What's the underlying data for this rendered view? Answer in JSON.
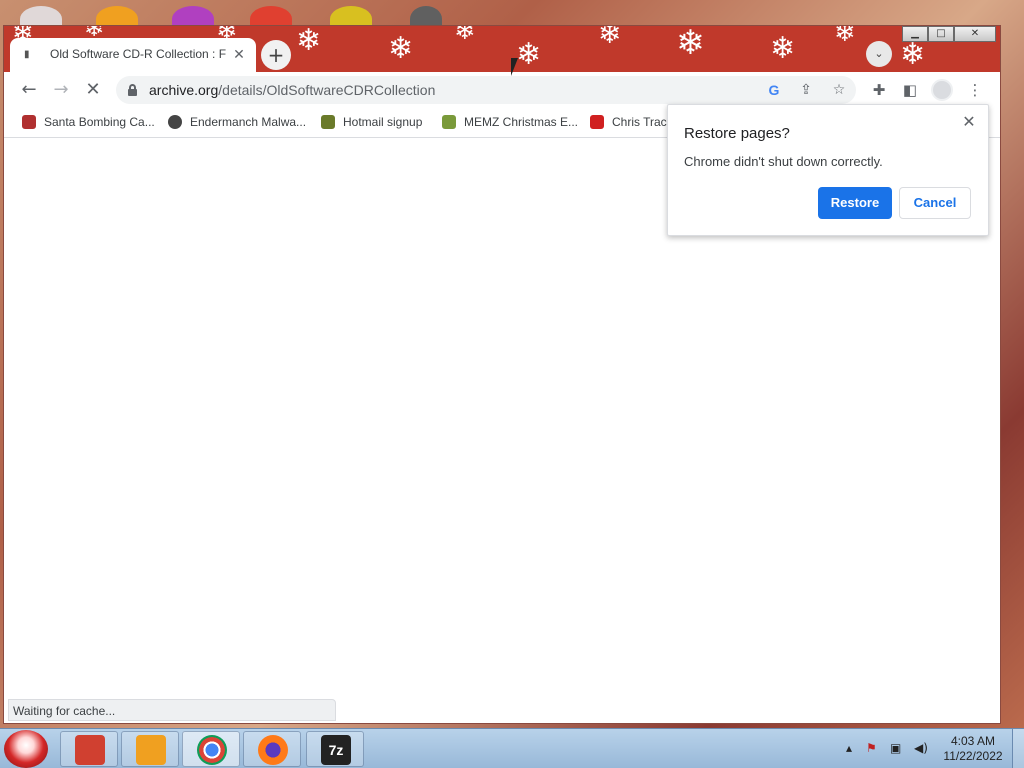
{
  "browser": {
    "tab": {
      "title": "Old Software CD-R Collection : F",
      "favicon": "archive-icon",
      "close_glyph": "✕"
    },
    "new_tab_glyph": "+",
    "tab_search_glyph": "⌄",
    "window_controls": [
      "minimize",
      "maximize",
      "close"
    ],
    "url_host": "archive.org",
    "url_path": "/details/OldSoftwareCDRCollection",
    "google_glyph": "G",
    "status_text": "Waiting for cache..."
  },
  "bookmarks": [
    {
      "label": "Santa Bombing Ca...",
      "icon": "santa-icon",
      "color": "#b03030"
    },
    {
      "label": "Endermanch Malwa...",
      "icon": "skull-icon",
      "color": "#444444"
    },
    {
      "label": "Hotmail signup",
      "icon": "people-icon",
      "color": "#6a7a2a"
    },
    {
      "label": "MEMZ Christmas E...",
      "icon": "sled-icon",
      "color": "#7a9a3a"
    },
    {
      "label": "Chris Track",
      "icon": "ornament-icon",
      "color": "#d02020"
    }
  ],
  "restore_dialog": {
    "title": "Restore pages?",
    "message": "Chrome didn't shut down correctly.",
    "restore_label": "Restore",
    "cancel_label": "Cancel",
    "close_glyph": "✕"
  },
  "taskbar": {
    "apps": [
      {
        "name": "file-explorer-icon",
        "color": "#d04030"
      },
      {
        "name": "media-player-icon",
        "color": "#f0a020"
      },
      {
        "name": "chrome-icon",
        "color": "#4285f4"
      },
      {
        "name": "firefox-icon",
        "color": "#ff7a18"
      },
      {
        "name": "7zip-icon",
        "color": "#222222"
      }
    ],
    "time": "4:03 AM",
    "date": "11/22/2022"
  },
  "colors": {
    "titlebar": "#c0392b",
    "accent": "#1a73e8"
  }
}
